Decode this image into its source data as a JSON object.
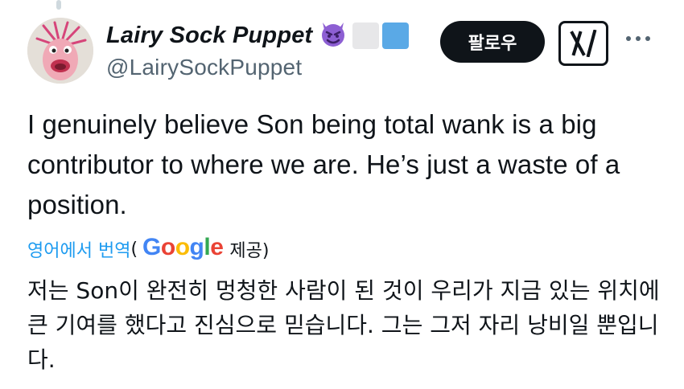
{
  "author": {
    "display_name": "Lairy Sock Puppet",
    "handle": "@LairySockPuppet",
    "badges": [
      "smiling-devil-emoji",
      "grey-flag-emoji",
      "blue-flag-emoji"
    ]
  },
  "actions": {
    "follow_label": "팔로우",
    "grok_icon": "grok-icon",
    "more_icon": "more-options-icon"
  },
  "tweet": {
    "text": "I genuinely believe Son being total wank is a big contributor to where we are. He’s just a waste of a position."
  },
  "translation": {
    "link_label": "영어에서 번역",
    "open_paren": "(",
    "provider": "Google",
    "provided_label": "제공)",
    "text": "저는 Son이 완전히 멍청한 사람이 된 것이 우리가 지금 있는 위치에 큰 기여를 했다고 진심으로 믿습니다. 그는 그저 자리 낭비일 뿐입니다."
  },
  "colors": {
    "text": "#0f1419",
    "secondary": "#536471",
    "link": "#1d9bf0",
    "follow_bg": "#0f1419"
  }
}
